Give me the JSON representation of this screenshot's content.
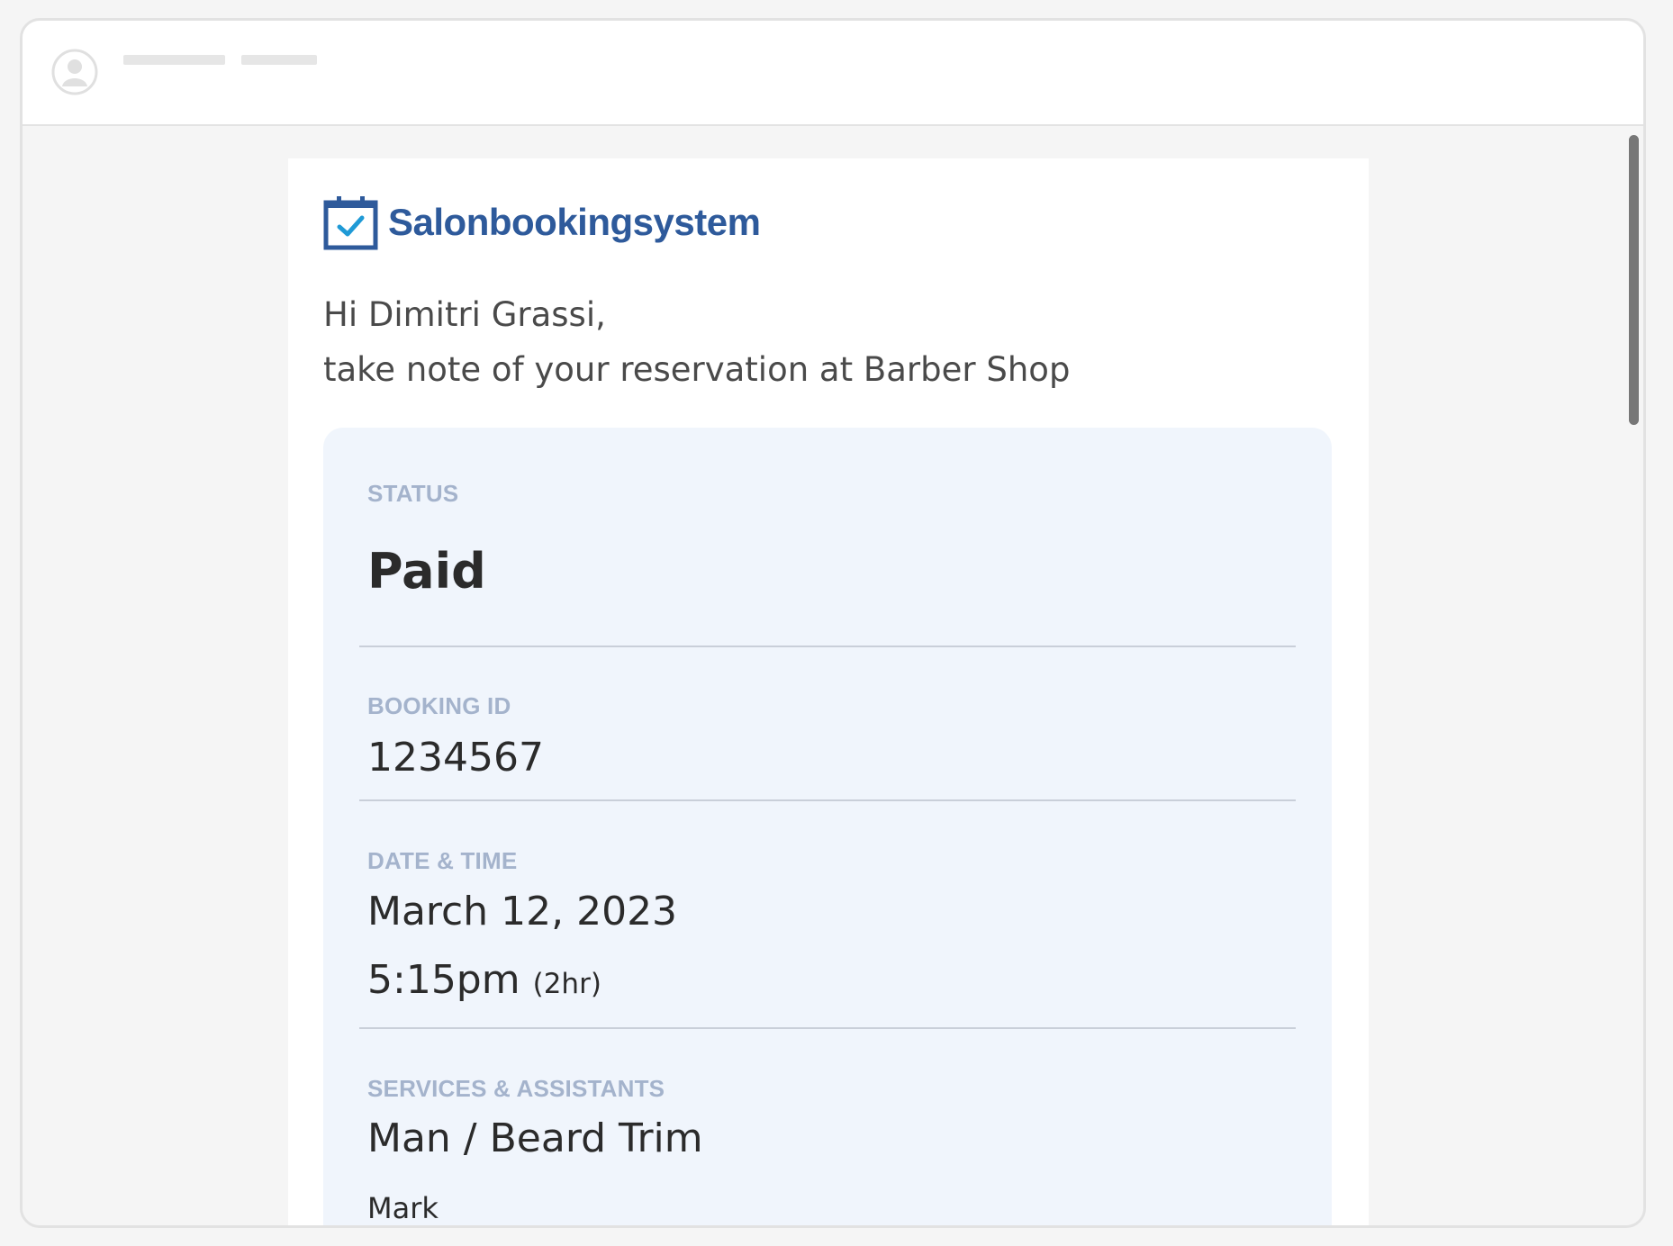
{
  "brand": {
    "name": "Salonbookingsystem",
    "color": "#2e5a9b",
    "icon": "calendar-check-icon"
  },
  "greeting": {
    "line1": "Hi Dimitri Grassi,",
    "line2": "take note of your reservation at Barber Shop"
  },
  "booking": {
    "status_label": "STATUS",
    "status": "Paid",
    "id_label": "BOOKING ID",
    "id": "1234567",
    "datetime_label": "DATE & TIME",
    "date": "March 12, 2023",
    "time": "5:15pm",
    "duration": "(2hr)",
    "services_label": "SERVICES & ASSISTANTS",
    "service": "Man / Beard Trim",
    "assistant": "Mark"
  },
  "colors": {
    "card_background": "#f0f5fc",
    "label": "#a4b3cc",
    "text": "#2b2b2b"
  }
}
